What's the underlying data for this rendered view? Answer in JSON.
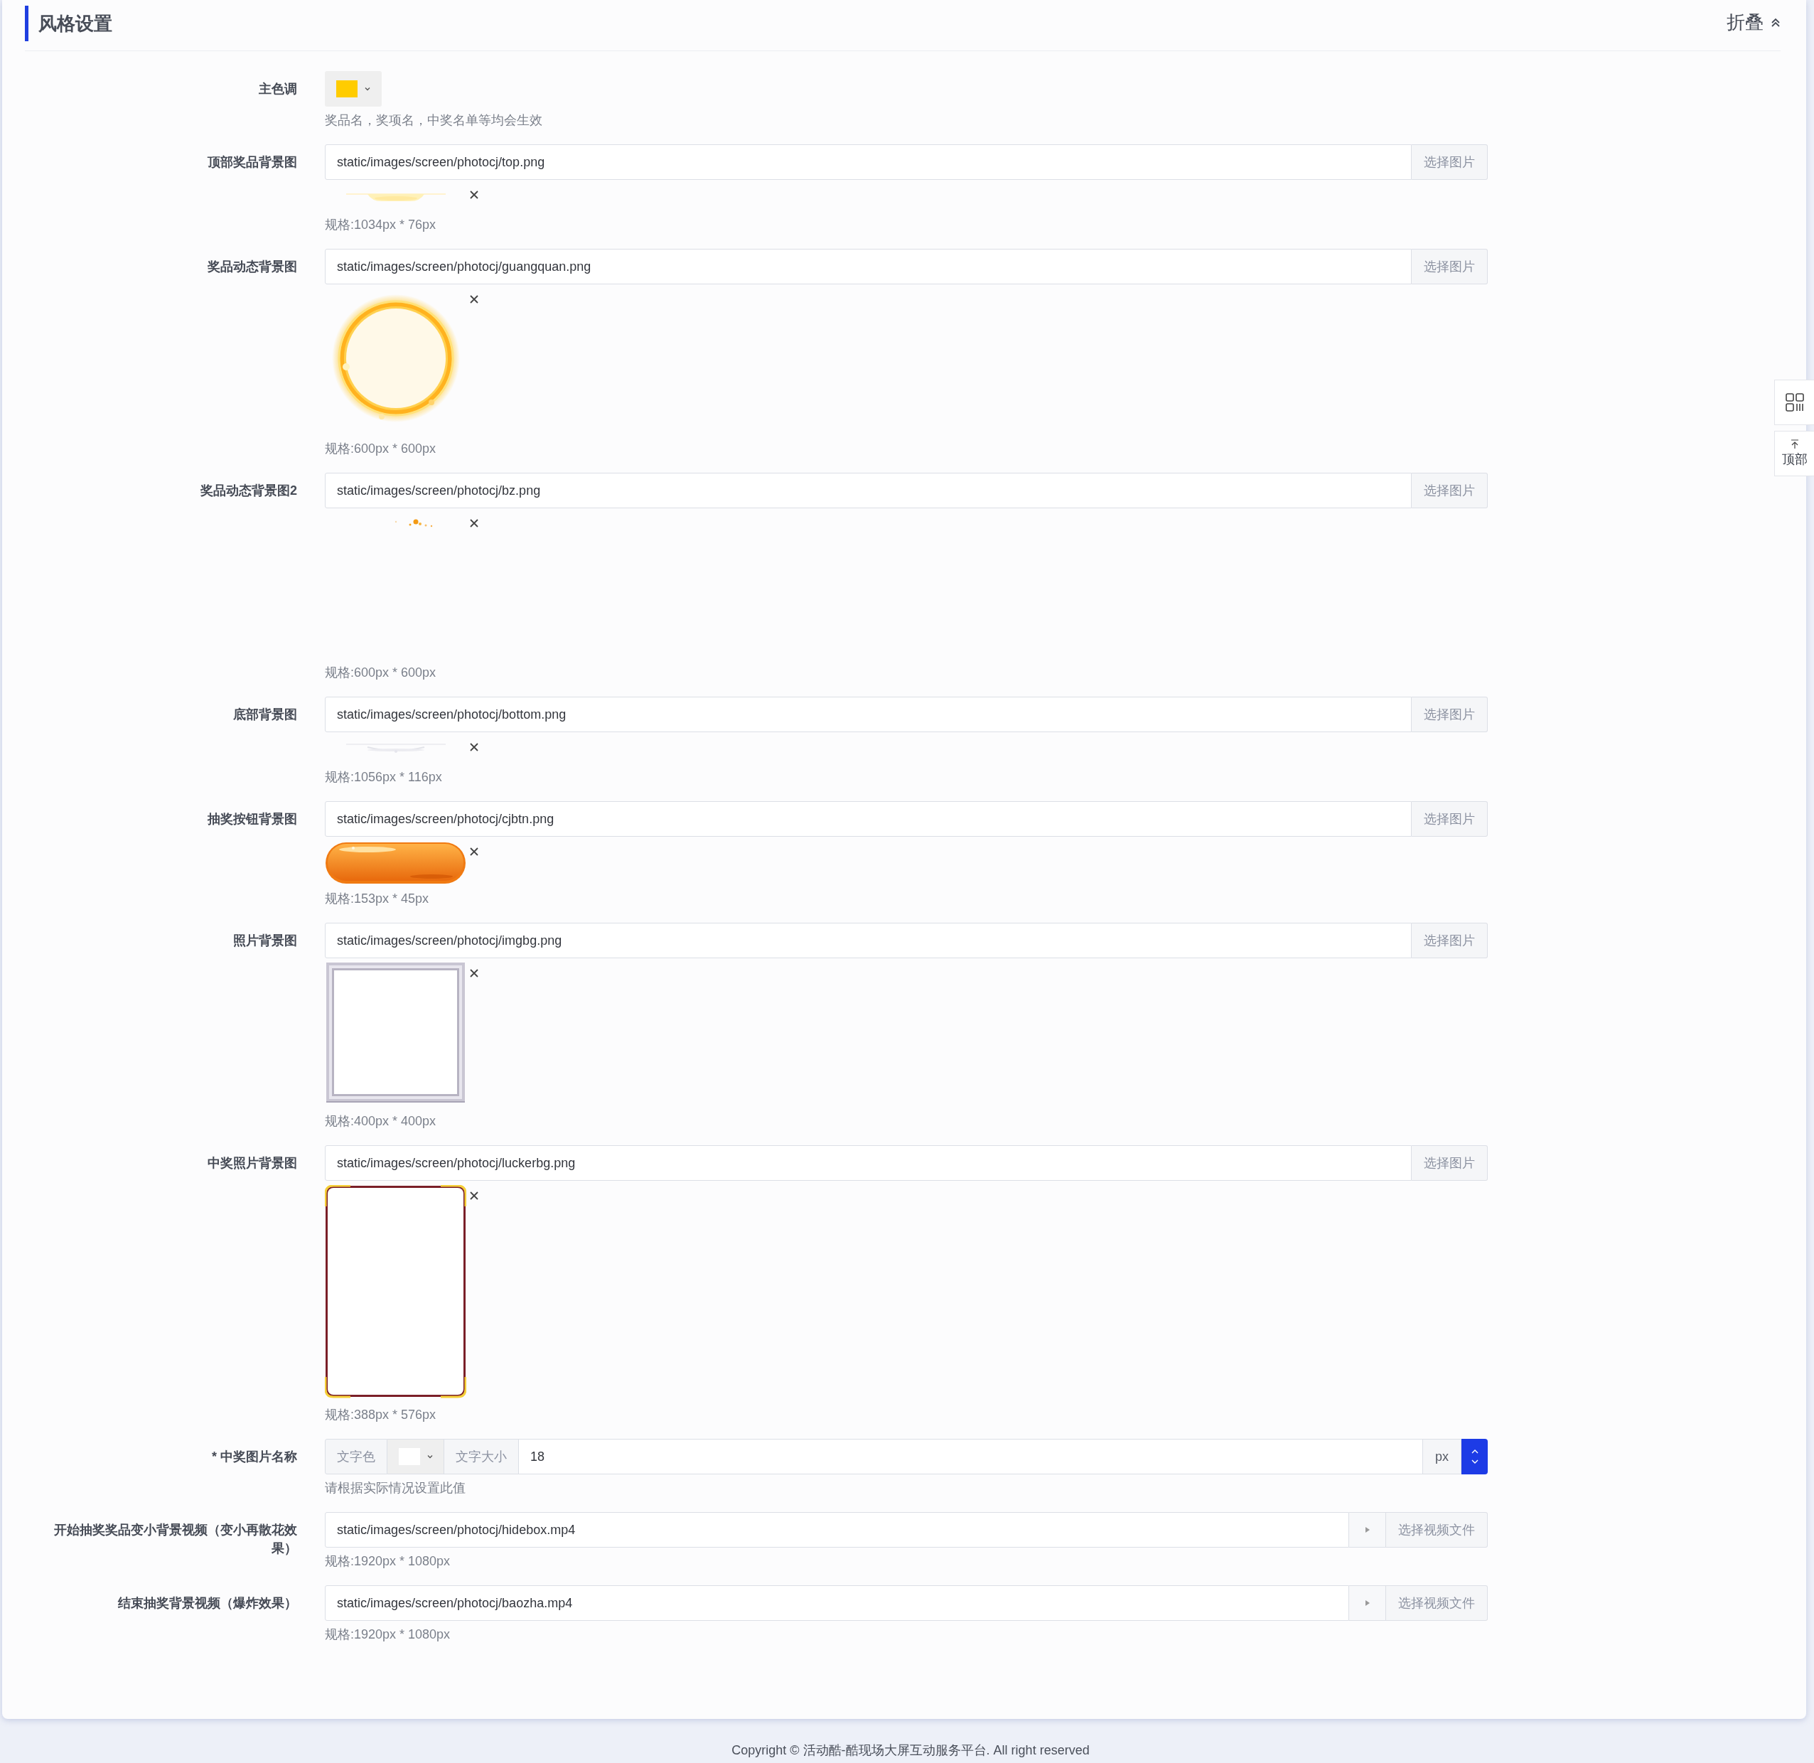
{
  "section": {
    "title": "风格设置",
    "collapse": "折叠"
  },
  "fields": [
    {
      "kind": "color",
      "label": "主色调",
      "color": "#ffcc00",
      "hint": "奖品名，奖项名，中奖名单等均会生效"
    },
    {
      "label": "顶部奖品背景图",
      "value": "static/images/screen/photocj/top.png",
      "button": "选择图片",
      "spec": "规格:1034px * 76px"
    },
    {
      "label": "奖品动态背景图",
      "value": "static/images/screen/photocj/guangquan.png",
      "button": "选择图片",
      "spec": "规格:600px * 600px"
    },
    {
      "label": "奖品动态背景图2",
      "value": "static/images/screen/photocj/bz.png",
      "button": "选择图片",
      "spec": "规格:600px * 600px"
    },
    {
      "label": "底部背景图",
      "value": "static/images/screen/photocj/bottom.png",
      "button": "选择图片",
      "spec": "规格:1056px * 116px"
    },
    {
      "label": "抽奖按钮背景图",
      "value": "static/images/screen/photocj/cjbtn.png",
      "button": "选择图片",
      "spec": "规格:153px * 45px"
    },
    {
      "label": "照片背景图",
      "value": "static/images/screen/photocj/imgbg.png",
      "button": "选择图片",
      "spec": "规格:400px * 400px"
    },
    {
      "label": "中奖照片背景图",
      "value": "static/images/screen/photocj/luckerbg.png",
      "button": "选择图片",
      "spec": "规格:388px * 576px"
    },
    {
      "kind": "text-style",
      "label": "* 中奖图片名称",
      "color_label": "文字色",
      "color": "#ffffff",
      "size_label": "文字大小",
      "value": "18",
      "unit": "px",
      "hint": "请根据实际情况设置此值"
    },
    {
      "kind": "video",
      "label": "开始抽奖奖品变小背景视频（变小再散花效果）",
      "value": "static/images/screen/photocj/hidebox.mp4",
      "button": "选择视频文件",
      "spec": "规格:1920px * 1080px"
    },
    {
      "kind": "video",
      "label": "结束抽奖背景视频（爆炸效果）",
      "value": "static/images/screen/photocj/baozha.mp4",
      "button": "选择视频文件",
      "spec": "规格:1920px * 1080px"
    }
  ],
  "side_tools": [
    {
      "kind": "grid"
    },
    {
      "kind": "top",
      "label": "顶部"
    }
  ],
  "footer": "Copyright © 活动酷-酷现场大屏互动服务平台. All right reserved"
}
